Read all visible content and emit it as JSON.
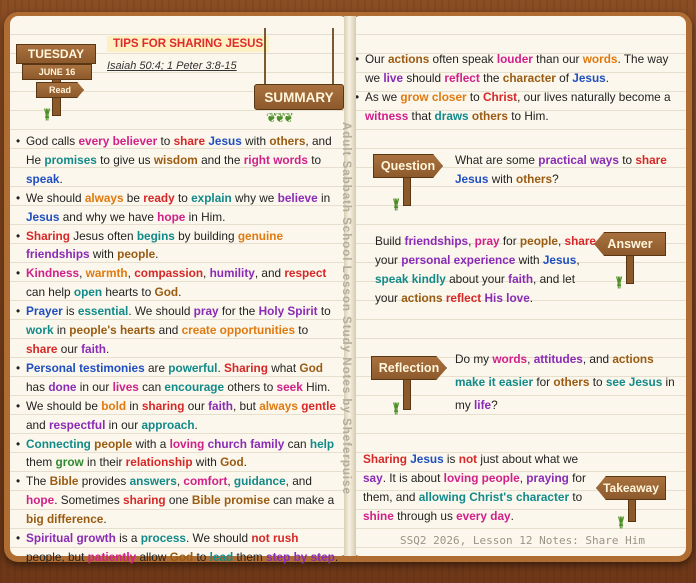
{
  "date_sign": {
    "day": "TUESDAY",
    "date": "JUNE 16",
    "read": "Read"
  },
  "title": "TIPS FOR SHARING JESUS",
  "reference": "Isaiah 50:4; 1 Peter 3:8-15",
  "summary_sign": "SUMMARY",
  "spine_text": "Adult Sabbath School Lesson Study Notes by Sheferpuise",
  "footer": "SSQ2 2026, Lesson 12 Notes: Share Him",
  "signs": {
    "question": "Question",
    "answer": "Answer",
    "reflection": "Reflection",
    "takeaway": "Takeaway"
  },
  "left_bullets": [
    [
      [
        "God calls ",
        ""
      ],
      [
        "every believer",
        "m"
      ],
      [
        " to ",
        ""
      ],
      [
        "share",
        "r"
      ],
      [
        " ",
        ""
      ],
      [
        "Jesus",
        "b"
      ],
      [
        " with ",
        ""
      ],
      [
        "others",
        "br"
      ],
      [
        ", and He ",
        ""
      ],
      [
        "promises",
        "t"
      ],
      [
        " to give us ",
        ""
      ],
      [
        "wisdom",
        "br"
      ],
      [
        " and the ",
        ""
      ],
      [
        "right words",
        "m"
      ],
      [
        " to ",
        ""
      ],
      [
        "speak",
        "b"
      ],
      [
        ".",
        ""
      ]
    ],
    [
      [
        "We should ",
        ""
      ],
      [
        "always",
        "o"
      ],
      [
        " be ",
        ""
      ],
      [
        "ready",
        "r"
      ],
      [
        " to ",
        ""
      ],
      [
        "explain",
        "t"
      ],
      [
        " why we ",
        ""
      ],
      [
        "believe",
        "p"
      ],
      [
        " in ",
        ""
      ],
      [
        "Jesus",
        "b"
      ],
      [
        " and why we have ",
        ""
      ],
      [
        "hope",
        "m"
      ],
      [
        " in Him.",
        ""
      ]
    ],
    [
      [
        "Sharing",
        "r"
      ],
      [
        " Jesus often ",
        ""
      ],
      [
        "begins",
        "t"
      ],
      [
        " by building ",
        ""
      ],
      [
        "genuine",
        "o"
      ],
      [
        " ",
        ""
      ],
      [
        "friendships",
        "p"
      ],
      [
        " with ",
        ""
      ],
      [
        "people",
        "br"
      ],
      [
        ".",
        ""
      ]
    ],
    [
      [
        "Kindness",
        "m"
      ],
      [
        ", ",
        ""
      ],
      [
        "warmth",
        "o"
      ],
      [
        ", ",
        ""
      ],
      [
        "compassion",
        "r"
      ],
      [
        ", ",
        ""
      ],
      [
        "humility",
        "p"
      ],
      [
        ", and ",
        ""
      ],
      [
        "respect",
        "r"
      ],
      [
        " can help ",
        ""
      ],
      [
        "open",
        "t"
      ],
      [
        " hearts to ",
        ""
      ],
      [
        "God",
        "br"
      ],
      [
        ".",
        ""
      ]
    ],
    [
      [
        "Prayer",
        "b"
      ],
      [
        " is ",
        ""
      ],
      [
        "essential",
        "t"
      ],
      [
        ". We should ",
        ""
      ],
      [
        "pray",
        "p"
      ],
      [
        " for the ",
        ""
      ],
      [
        "Holy Spirit",
        "p"
      ],
      [
        " to ",
        ""
      ],
      [
        "work",
        "t"
      ],
      [
        " in ",
        ""
      ],
      [
        "people's hearts",
        "br"
      ],
      [
        " and ",
        ""
      ],
      [
        "create opportunities",
        "o"
      ],
      [
        " to ",
        ""
      ],
      [
        "share",
        "r"
      ],
      [
        " our ",
        ""
      ],
      [
        "faith",
        "p"
      ],
      [
        ".",
        ""
      ]
    ],
    [
      [
        "Personal testimonies",
        "b"
      ],
      [
        " are ",
        ""
      ],
      [
        "powerful",
        "t"
      ],
      [
        ". ",
        ""
      ],
      [
        "Sharing",
        "r"
      ],
      [
        " what ",
        ""
      ],
      [
        "God",
        "br"
      ],
      [
        " has ",
        ""
      ],
      [
        "done",
        "p"
      ],
      [
        " in our ",
        ""
      ],
      [
        "lives",
        "m"
      ],
      [
        " can ",
        ""
      ],
      [
        "encourage",
        "t"
      ],
      [
        " others to ",
        ""
      ],
      [
        "seek",
        "m"
      ],
      [
        " Him.",
        ""
      ]
    ],
    [
      [
        "We should be ",
        ""
      ],
      [
        "bold",
        "o"
      ],
      [
        " in ",
        ""
      ],
      [
        "sharing",
        "r"
      ],
      [
        " our ",
        ""
      ],
      [
        "faith",
        "p"
      ],
      [
        ", but ",
        ""
      ],
      [
        "always",
        "o"
      ],
      [
        " ",
        ""
      ],
      [
        "gentle",
        "r"
      ],
      [
        " and ",
        ""
      ],
      [
        "respectful",
        "p"
      ],
      [
        " in our ",
        ""
      ],
      [
        "approach",
        "t"
      ],
      [
        ".",
        ""
      ]
    ],
    [
      [
        "Connecting",
        "t"
      ],
      [
        " ",
        ""
      ],
      [
        "people",
        "br"
      ],
      [
        " with a ",
        ""
      ],
      [
        "loving",
        "m"
      ],
      [
        " ",
        ""
      ],
      [
        "church family",
        "p"
      ],
      [
        " can ",
        ""
      ],
      [
        "help",
        "t"
      ],
      [
        " them ",
        ""
      ],
      [
        "grow",
        "g"
      ],
      [
        " in their ",
        ""
      ],
      [
        "relationship",
        "r"
      ],
      [
        " with ",
        ""
      ],
      [
        "God",
        "br"
      ],
      [
        ".",
        ""
      ]
    ],
    [
      [
        "The ",
        ""
      ],
      [
        "Bible",
        "br"
      ],
      [
        " provides ",
        ""
      ],
      [
        "answers",
        "t"
      ],
      [
        ", ",
        ""
      ],
      [
        "comfort",
        "m"
      ],
      [
        ", ",
        ""
      ],
      [
        "guidance",
        "t"
      ],
      [
        ", and ",
        ""
      ],
      [
        "hope",
        "m"
      ],
      [
        ". Sometimes ",
        ""
      ],
      [
        "sharing",
        "r"
      ],
      [
        " one ",
        ""
      ],
      [
        "Bible promise",
        "br"
      ],
      [
        " can make a ",
        ""
      ],
      [
        "big difference",
        "br"
      ],
      [
        ".",
        ""
      ]
    ],
    [
      [
        "Spiritual growth",
        "p"
      ],
      [
        " is a ",
        ""
      ],
      [
        "process",
        "t"
      ],
      [
        ". We should ",
        ""
      ],
      [
        "not rush",
        "r"
      ],
      [
        " people, but ",
        ""
      ],
      [
        "patiently",
        "m"
      ],
      [
        " allow ",
        ""
      ],
      [
        "God",
        "br"
      ],
      [
        " to ",
        ""
      ],
      [
        "lead",
        "t"
      ],
      [
        " them ",
        ""
      ],
      [
        "step by step",
        "p"
      ],
      [
        ".",
        ""
      ]
    ]
  ],
  "right_bullets": [
    [
      [
        "Our ",
        ""
      ],
      [
        "actions",
        "br"
      ],
      [
        " often speak ",
        ""
      ],
      [
        "louder",
        "m"
      ],
      [
        " than our ",
        ""
      ],
      [
        "words",
        "o"
      ],
      [
        ". The way we ",
        ""
      ],
      [
        "live",
        "p"
      ],
      [
        " should ",
        ""
      ],
      [
        "reflect",
        "m"
      ],
      [
        " the ",
        ""
      ],
      [
        "character",
        "br"
      ],
      [
        " of ",
        ""
      ],
      [
        "Jesus",
        "b"
      ],
      [
        ".",
        ""
      ]
    ],
    [
      [
        "As we ",
        ""
      ],
      [
        "grow closer",
        "o"
      ],
      [
        " to ",
        ""
      ],
      [
        "Christ",
        "r"
      ],
      [
        ", our lives naturally become a ",
        ""
      ],
      [
        "witness",
        "m"
      ],
      [
        " that ",
        ""
      ],
      [
        "draws",
        "t"
      ],
      [
        " ",
        ""
      ],
      [
        "others",
        "br"
      ],
      [
        " to Him.",
        ""
      ]
    ]
  ],
  "question_text": [
    [
      "What are some ",
      ""
    ],
    [
      "practical ways",
      "p"
    ],
    [
      " to ",
      ""
    ],
    [
      "share",
      "r"
    ],
    [
      " ",
      ""
    ],
    [
      "Jesus",
      "b"
    ],
    [
      " with ",
      ""
    ],
    [
      "others",
      "br"
    ],
    [
      "?",
      ""
    ]
  ],
  "answer_text": [
    [
      "Build ",
      ""
    ],
    [
      "friendships",
      "p"
    ],
    [
      ", ",
      ""
    ],
    [
      "pray",
      "m"
    ],
    [
      " for ",
      ""
    ],
    [
      "people",
      "br"
    ],
    [
      ", ",
      ""
    ],
    [
      "share",
      "r"
    ],
    [
      " your ",
      ""
    ],
    [
      "personal experience",
      "p"
    ],
    [
      " with ",
      ""
    ],
    [
      "Jesus",
      "b"
    ],
    [
      ", ",
      ""
    ],
    [
      "speak kindly",
      "t"
    ],
    [
      " about your ",
      ""
    ],
    [
      "faith",
      "p"
    ],
    [
      ", and let your ",
      ""
    ],
    [
      "actions",
      "br"
    ],
    [
      " ",
      ""
    ],
    [
      "reflect",
      "r"
    ],
    [
      " ",
      ""
    ],
    [
      "His love",
      "p"
    ],
    [
      ".",
      ""
    ]
  ],
  "reflection_text": [
    [
      "Do my ",
      ""
    ],
    [
      "words",
      "m"
    ],
    [
      ", ",
      ""
    ],
    [
      "attitudes",
      "p"
    ],
    [
      ", and ",
      ""
    ],
    [
      "actions",
      "br"
    ],
    [
      " ",
      ""
    ],
    [
      "make it easier",
      "t"
    ],
    [
      " for ",
      ""
    ],
    [
      "others",
      "br"
    ],
    [
      " to ",
      ""
    ],
    [
      "see Jesus",
      "t"
    ],
    [
      " in my ",
      ""
    ],
    [
      "life",
      "p"
    ],
    [
      "?",
      ""
    ]
  ],
  "takeaway_text": [
    [
      "Sharing",
      "r"
    ],
    [
      " ",
      ""
    ],
    [
      "Jesus",
      "b"
    ],
    [
      " is ",
      ""
    ],
    [
      "not",
      "r"
    ],
    [
      " just about what we ",
      ""
    ],
    [
      "say",
      "p"
    ],
    [
      ". It is about ",
      ""
    ],
    [
      "loving people",
      "m"
    ],
    [
      ", ",
      ""
    ],
    [
      "praying",
      "p"
    ],
    [
      " for them, and ",
      ""
    ],
    [
      "allowing Christ's character",
      "t"
    ],
    [
      " to ",
      ""
    ],
    [
      "shine",
      "m"
    ],
    [
      " through us ",
      ""
    ],
    [
      "every day",
      "m"
    ],
    [
      ".",
      ""
    ]
  ]
}
